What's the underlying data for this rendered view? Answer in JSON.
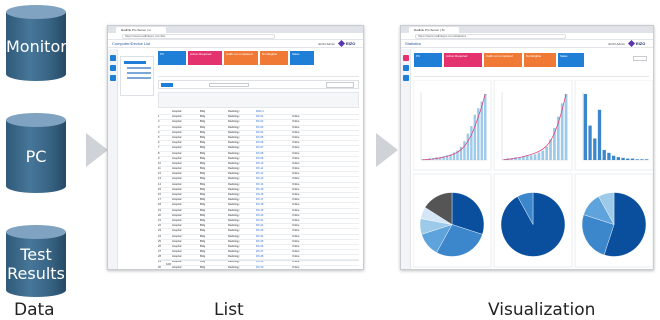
{
  "cylinders": [
    {
      "label": "Monitor"
    },
    {
      "label": "PC"
    },
    {
      "label": "Test Results",
      "lines": [
        "Test",
        "Results"
      ]
    }
  ],
  "captions": {
    "data": "Data",
    "list": "List",
    "visualization": "Visualization"
  },
  "list_window": {
    "tab": "Radlink Pro Server | Li",
    "url": "https://www.radlinkpro.com/list",
    "app_title": "Computer/Device List",
    "user": "ECIO Admin",
    "logo": "EIZO",
    "menu": [
      {
        "label": "PC",
        "color": "#1f7fd6"
      },
      {
        "label": "Action Required",
        "color": "#e3326d"
      },
      {
        "label": "Calib not completed",
        "color": "#f07a35"
      },
      {
        "label": "Not Eligible",
        "color": "#f07a35"
      },
      {
        "label": "Sales",
        "color": "#1f7fd6"
      }
    ],
    "rows": [
      [
        "",
        "Hospital",
        "Bldg",
        "Radiology",
        "RAD-1",
        "",
        "",
        "",
        ""
      ],
      [
        "1",
        "Hospital",
        "Bldg",
        "Radiology",
        "RX-01",
        "",
        "Online",
        "",
        ""
      ],
      [
        "2",
        "Hospital",
        "Bldg",
        "Radiology",
        "RX-02",
        "",
        "Online",
        "",
        ""
      ],
      [
        "3",
        "Hospital",
        "Bldg",
        "Radiology",
        "RX-03",
        "",
        "Online",
        "",
        ""
      ],
      [
        "4",
        "Hospital",
        "Bldg",
        "Radiology",
        "RX-04",
        "",
        "Online",
        "",
        ""
      ],
      [
        "5",
        "Hospital",
        "Bldg",
        "Radiology",
        "RX-05",
        "",
        "Online",
        "",
        ""
      ],
      [
        "6",
        "Hospital",
        "Bldg",
        "Radiology",
        "RX-06",
        "",
        "Online",
        "",
        ""
      ],
      [
        "7",
        "Hospital",
        "Bldg",
        "Radiology",
        "RX-07",
        "",
        "Online",
        "",
        ""
      ],
      [
        "8",
        "Hospital",
        "Bldg",
        "Radiology",
        "RX-08",
        "",
        "Online",
        "",
        ""
      ],
      [
        "9",
        "Hospital",
        "Bldg",
        "Radiology",
        "RX-09",
        "",
        "Online",
        "",
        ""
      ],
      [
        "10",
        "Hospital",
        "Bldg",
        "Radiology",
        "RX-10",
        "",
        "Online",
        "",
        ""
      ],
      [
        "11",
        "Hospital",
        "Bldg",
        "Radiology",
        "RX-11",
        "",
        "Online",
        "",
        ""
      ],
      [
        "12",
        "Hospital",
        "Bldg",
        "Radiology",
        "RX-12",
        "",
        "Online",
        "",
        ""
      ],
      [
        "13",
        "Hospital",
        "Bldg",
        "Radiology",
        "RX-13",
        "",
        "Online",
        "",
        ""
      ],
      [
        "14",
        "Hospital",
        "Bldg",
        "Radiology",
        "RX-14",
        "",
        "Online",
        "",
        ""
      ],
      [
        "15",
        "Hospital",
        "Bldg",
        "Radiology",
        "RX-15",
        "",
        "Online",
        "",
        ""
      ],
      [
        "16",
        "Hospital",
        "Bldg",
        "Radiology",
        "RX-16",
        "",
        "Online",
        "",
        ""
      ],
      [
        "17",
        "Hospital",
        "Bldg",
        "Radiology",
        "RX-17",
        "",
        "Online",
        "",
        ""
      ],
      [
        "18",
        "Hospital",
        "Bldg",
        "Radiology",
        "RX-18",
        "",
        "Online",
        "",
        ""
      ],
      [
        "19",
        "Hospital",
        "Bldg",
        "Radiology",
        "RX-19",
        "",
        "Online",
        "",
        ""
      ],
      [
        "20",
        "Hospital",
        "Bldg",
        "Radiology",
        "RX-20",
        "",
        "Online",
        "",
        ""
      ],
      [
        "21",
        "Hospital",
        "Bldg",
        "Radiology",
        "RX-21",
        "",
        "Online",
        "",
        ""
      ],
      [
        "22",
        "Hospital",
        "Bldg",
        "Radiology",
        "RX-22",
        "",
        "Online",
        "",
        ""
      ],
      [
        "23",
        "Hospital",
        "Bldg",
        "Radiology",
        "RX-23",
        "",
        "Online",
        "",
        ""
      ],
      [
        "24",
        "Hospital",
        "Bldg",
        "Radiology",
        "RX-24",
        "",
        "Online",
        "",
        ""
      ],
      [
        "25",
        "Hospital",
        "Bldg",
        "Radiology",
        "RX-25",
        "",
        "Online",
        "",
        ""
      ],
      [
        "26",
        "Hospital",
        "Bldg",
        "Radiology",
        "RX-26",
        "",
        "Online",
        "",
        ""
      ],
      [
        "27",
        "Hospital",
        "Bldg",
        "Radiology",
        "RX-27",
        "",
        "Online",
        "",
        ""
      ],
      [
        "28",
        "Hospital",
        "Bldg",
        "Radiology",
        "RX-28",
        "",
        "Online",
        "",
        ""
      ],
      [
        "29",
        "Hospital",
        "Bldg",
        "Radiology",
        "RX-29",
        "",
        "Online",
        "",
        ""
      ],
      [
        "30",
        "Hospital",
        "Bldg",
        "Radiology",
        "RX-30",
        "",
        "Online",
        "",
        ""
      ],
      [
        "31",
        "Hospital",
        "Bldg",
        "Radiology",
        "RX-31",
        "",
        "Online",
        "",
        ""
      ],
      [
        "32",
        "Hospital",
        "Bldg",
        "Radiology",
        "RX-32",
        "",
        "Online",
        "",
        ""
      ]
    ],
    "footer": "100"
  },
  "viz_window": {
    "tab": "Radlink Pro Server | St",
    "url": "https://www.radlinkpro.com/statistics",
    "app_title": "Statistics",
    "user": "ECIO Admin",
    "logo": "EIZO",
    "menu": [
      {
        "label": "PC",
        "color": "#1f7fd6"
      },
      {
        "label": "Action Required",
        "color": "#e3326d"
      },
      {
        "label": "Calib not completed",
        "color": "#f07a35"
      },
      {
        "label": "Not Eligible",
        "color": "#f07a35"
      },
      {
        "label": "Sales",
        "color": "#1f7fd6"
      }
    ],
    "colors": {
      "dark": "#0a4f9e",
      "mid": "#3c86cc",
      "light": "#9ecaea",
      "pink": "#e3326d"
    },
    "charts": [
      {
        "bars": [
          1,
          1,
          2,
          2,
          3,
          3,
          4,
          5,
          6,
          8,
          10,
          14,
          20,
          28,
          36,
          48,
          55,
          62,
          70
        ]
      },
      {
        "bars": [
          1,
          2,
          2,
          3,
          3,
          4,
          5,
          5,
          6,
          8,
          10,
          14,
          22,
          34,
          46,
          60,
          70
        ]
      },
      {
        "bars": [
          92,
          48,
          30,
          70,
          14,
          10,
          6,
          4,
          3,
          2,
          2,
          1,
          1,
          1
        ]
      },
      {
        "slices": [
          0.3,
          0.28,
          0.12,
          0.08,
          0.06,
          0.16
        ]
      },
      {
        "slices": [
          0.92,
          0.08
        ]
      },
      {
        "slices": [
          0.55,
          0.25,
          0.12,
          0.08
        ]
      }
    ]
  }
}
